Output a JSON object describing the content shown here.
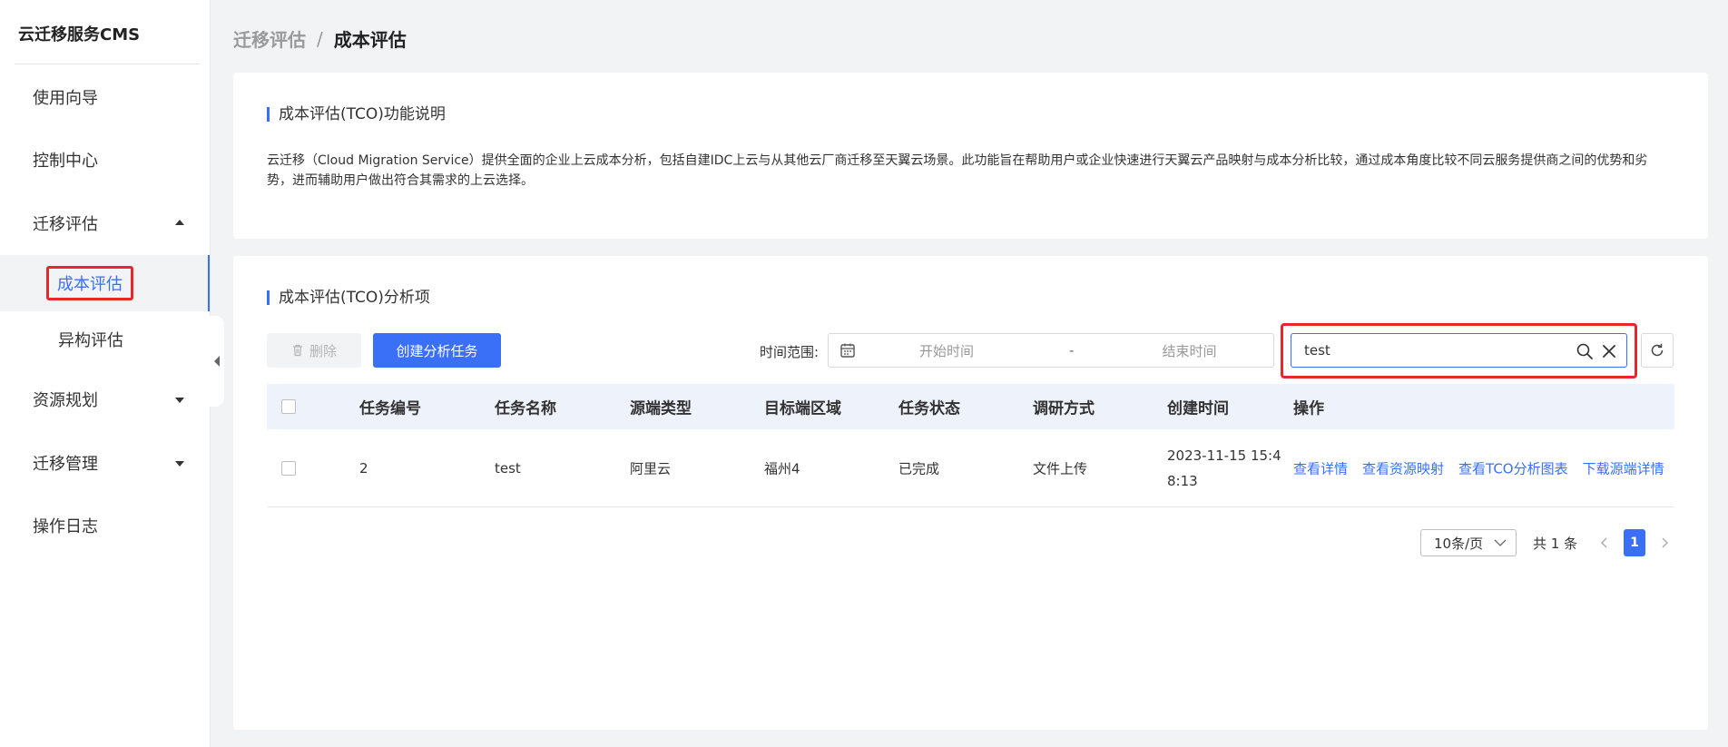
{
  "app": {
    "title": "云迁移服务CMS"
  },
  "sidebar": {
    "items": [
      {
        "label": "使用向导"
      },
      {
        "label": "控制中心"
      },
      {
        "label": "迁移评估",
        "expanded": true,
        "children": [
          {
            "label": "成本评估",
            "active": true
          },
          {
            "label": "异构评估"
          }
        ]
      },
      {
        "label": "资源规划",
        "expanded": false
      },
      {
        "label": "迁移管理",
        "expanded": false
      },
      {
        "label": "操作日志"
      }
    ]
  },
  "breadcrumb": {
    "parent": "迁移评估",
    "separator": "/",
    "current": "成本评估"
  },
  "info": {
    "title": "成本评估(TCO)功能说明",
    "description": "云迁移（Cloud Migration Service）提供全面的企业上云成本分析，包括自建IDC上云与从其他云厂商迁移至天翼云场景。此功能旨在帮助用户或企业快速进行天翼云产品映射与成本分析比较，通过成本角度比较不同云服务提供商之间的优势和劣势，进而辅助用户做出符合其需求的上云选择。"
  },
  "main": {
    "title": "成本评估(TCO)分析项",
    "toolbar": {
      "delete_label": "删除",
      "create_label": "创建分析任务",
      "time_range_label": "时间范围:",
      "start_placeholder": "开始时间",
      "range_separator": "-",
      "end_placeholder": "结束时间",
      "search_value": "test"
    },
    "table": {
      "columns": [
        "任务编号",
        "任务名称",
        "源端类型",
        "目标端区域",
        "任务状态",
        "调研方式",
        "创建时间",
        "操作"
      ],
      "rows": [
        {
          "id": "2",
          "name": "test",
          "source_type": "阿里云",
          "target_region": "福州4",
          "status": "已完成",
          "survey_method": "文件上传",
          "created_at": "2023-11-15 15:48:13",
          "actions": [
            "查看详情",
            "查看资源映射",
            "查看TCO分析图表",
            "下载源端详情"
          ]
        }
      ]
    },
    "pagination": {
      "page_size": "10条/页",
      "total": "共 1 条",
      "current_page": "1"
    }
  },
  "colors": {
    "accent": "#3a6ff7",
    "highlight": "#e8272b",
    "background": "#f2f3f5"
  }
}
